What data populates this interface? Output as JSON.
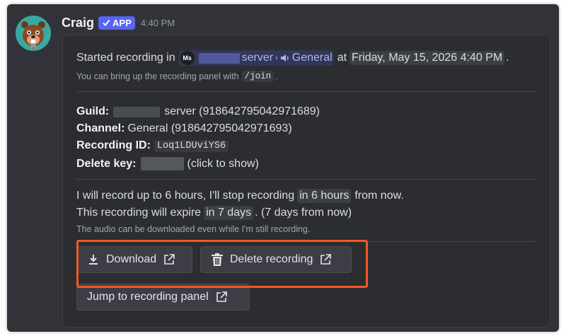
{
  "colors": {
    "accent": "#5865f2",
    "highlight": "#f15a22",
    "background": "#323339"
  },
  "message": {
    "author": "Craig",
    "badge": "APP",
    "timestamp": "4:40 PM"
  },
  "embed": {
    "started_prefix": "Started recording in",
    "server_icon_text": "Ms",
    "server_name": "server",
    "channel_name": "General",
    "at_text": "at",
    "date": "Friday, May 15, 2026 4:40 PM",
    "period": ".",
    "panel_hint_prefix": "You can bring up the recording panel with",
    "panel_hint_command": "/join",
    "panel_hint_suffix": ".",
    "guild_label": "Guild:",
    "guild_value": "server (918642795042971689)",
    "channel_label": "Channel:",
    "channel_value": "General (918642795042971693)",
    "recording_id_label": "Recording ID:",
    "recording_id": "Loq1LDUviYS6",
    "delete_key_label": "Delete key:",
    "delete_key_hint": "(click to show)",
    "limit_prefix": "I will record up to 6 hours, I'll stop recording",
    "limit_time": "in 6 hours",
    "limit_suffix": "from now.",
    "expire_prefix": "This recording will expire",
    "expire_time": "in 7 days",
    "expire_suffix": ". (7 days from now)",
    "download_note": "The audio can be downloaded even while I'm still recording."
  },
  "buttons": {
    "download": "Download",
    "delete": "Delete recording",
    "jump": "Jump to recording panel"
  }
}
